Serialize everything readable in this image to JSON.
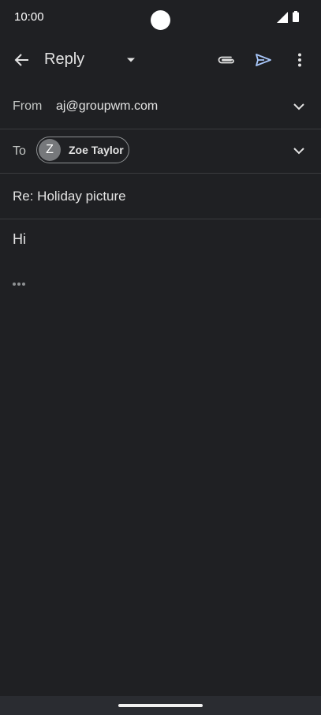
{
  "status_bar": {
    "time": "10:00",
    "icons": [
      "signal-icon",
      "battery-icon"
    ]
  },
  "app_bar": {
    "title": "Reply",
    "icons": [
      "back-arrow-icon",
      "dropdown-arrow-icon",
      "attachment-icon",
      "send-icon",
      "more-vert-icon"
    ],
    "send_color": "#a8c7fa"
  },
  "compose": {
    "from_label": "From",
    "from_value": "aj@groupwm.com",
    "to_label": "To",
    "recipient": {
      "initial": "Z",
      "name": "Zoe Taylor"
    },
    "subject": "Re: Holiday picture",
    "body": "Hi"
  }
}
